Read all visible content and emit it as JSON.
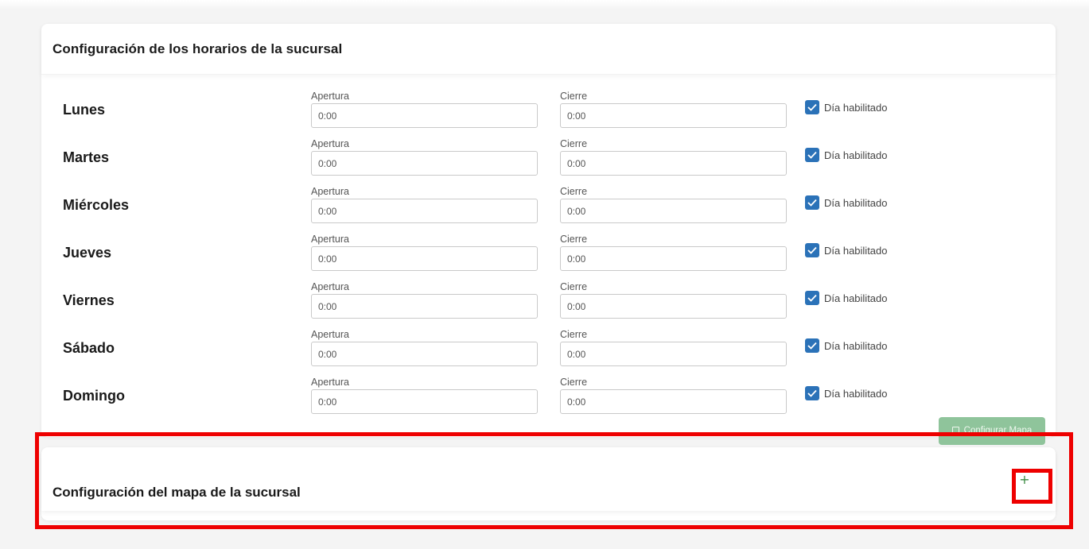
{
  "schedule_card": {
    "title": "Configuración de los horarios de la sucursal",
    "open_label": "Apertura",
    "close_label": "Cierre",
    "enabled_label": "Día habilitado",
    "days": [
      {
        "name": "Lunes",
        "open": "0:00",
        "close": "0:00",
        "enabled": true
      },
      {
        "name": "Martes",
        "open": "0:00",
        "close": "0:00",
        "enabled": true
      },
      {
        "name": "Miércoles",
        "open": "0:00",
        "close": "0:00",
        "enabled": true
      },
      {
        "name": "Jueves",
        "open": "0:00",
        "close": "0:00",
        "enabled": true
      },
      {
        "name": "Viernes",
        "open": "0:00",
        "close": "0:00",
        "enabled": true
      },
      {
        "name": "Sábado",
        "open": "0:00",
        "close": "0:00",
        "enabled": true
      },
      {
        "name": "Domingo",
        "open": "0:00",
        "close": "0:00",
        "enabled": true
      }
    ],
    "map_button_label": "Configurar Mapa",
    "map_button_icon": "map-icon"
  },
  "map_card": {
    "title": "Configuración del mapa de la sucursal",
    "expand_symbol": "+",
    "expand_icon": "plus-icon"
  },
  "colors": {
    "checkbox": "#2b72b8",
    "map_button": "#8fc49b",
    "expand": "#3a8a40",
    "highlight": "#ee0000"
  }
}
